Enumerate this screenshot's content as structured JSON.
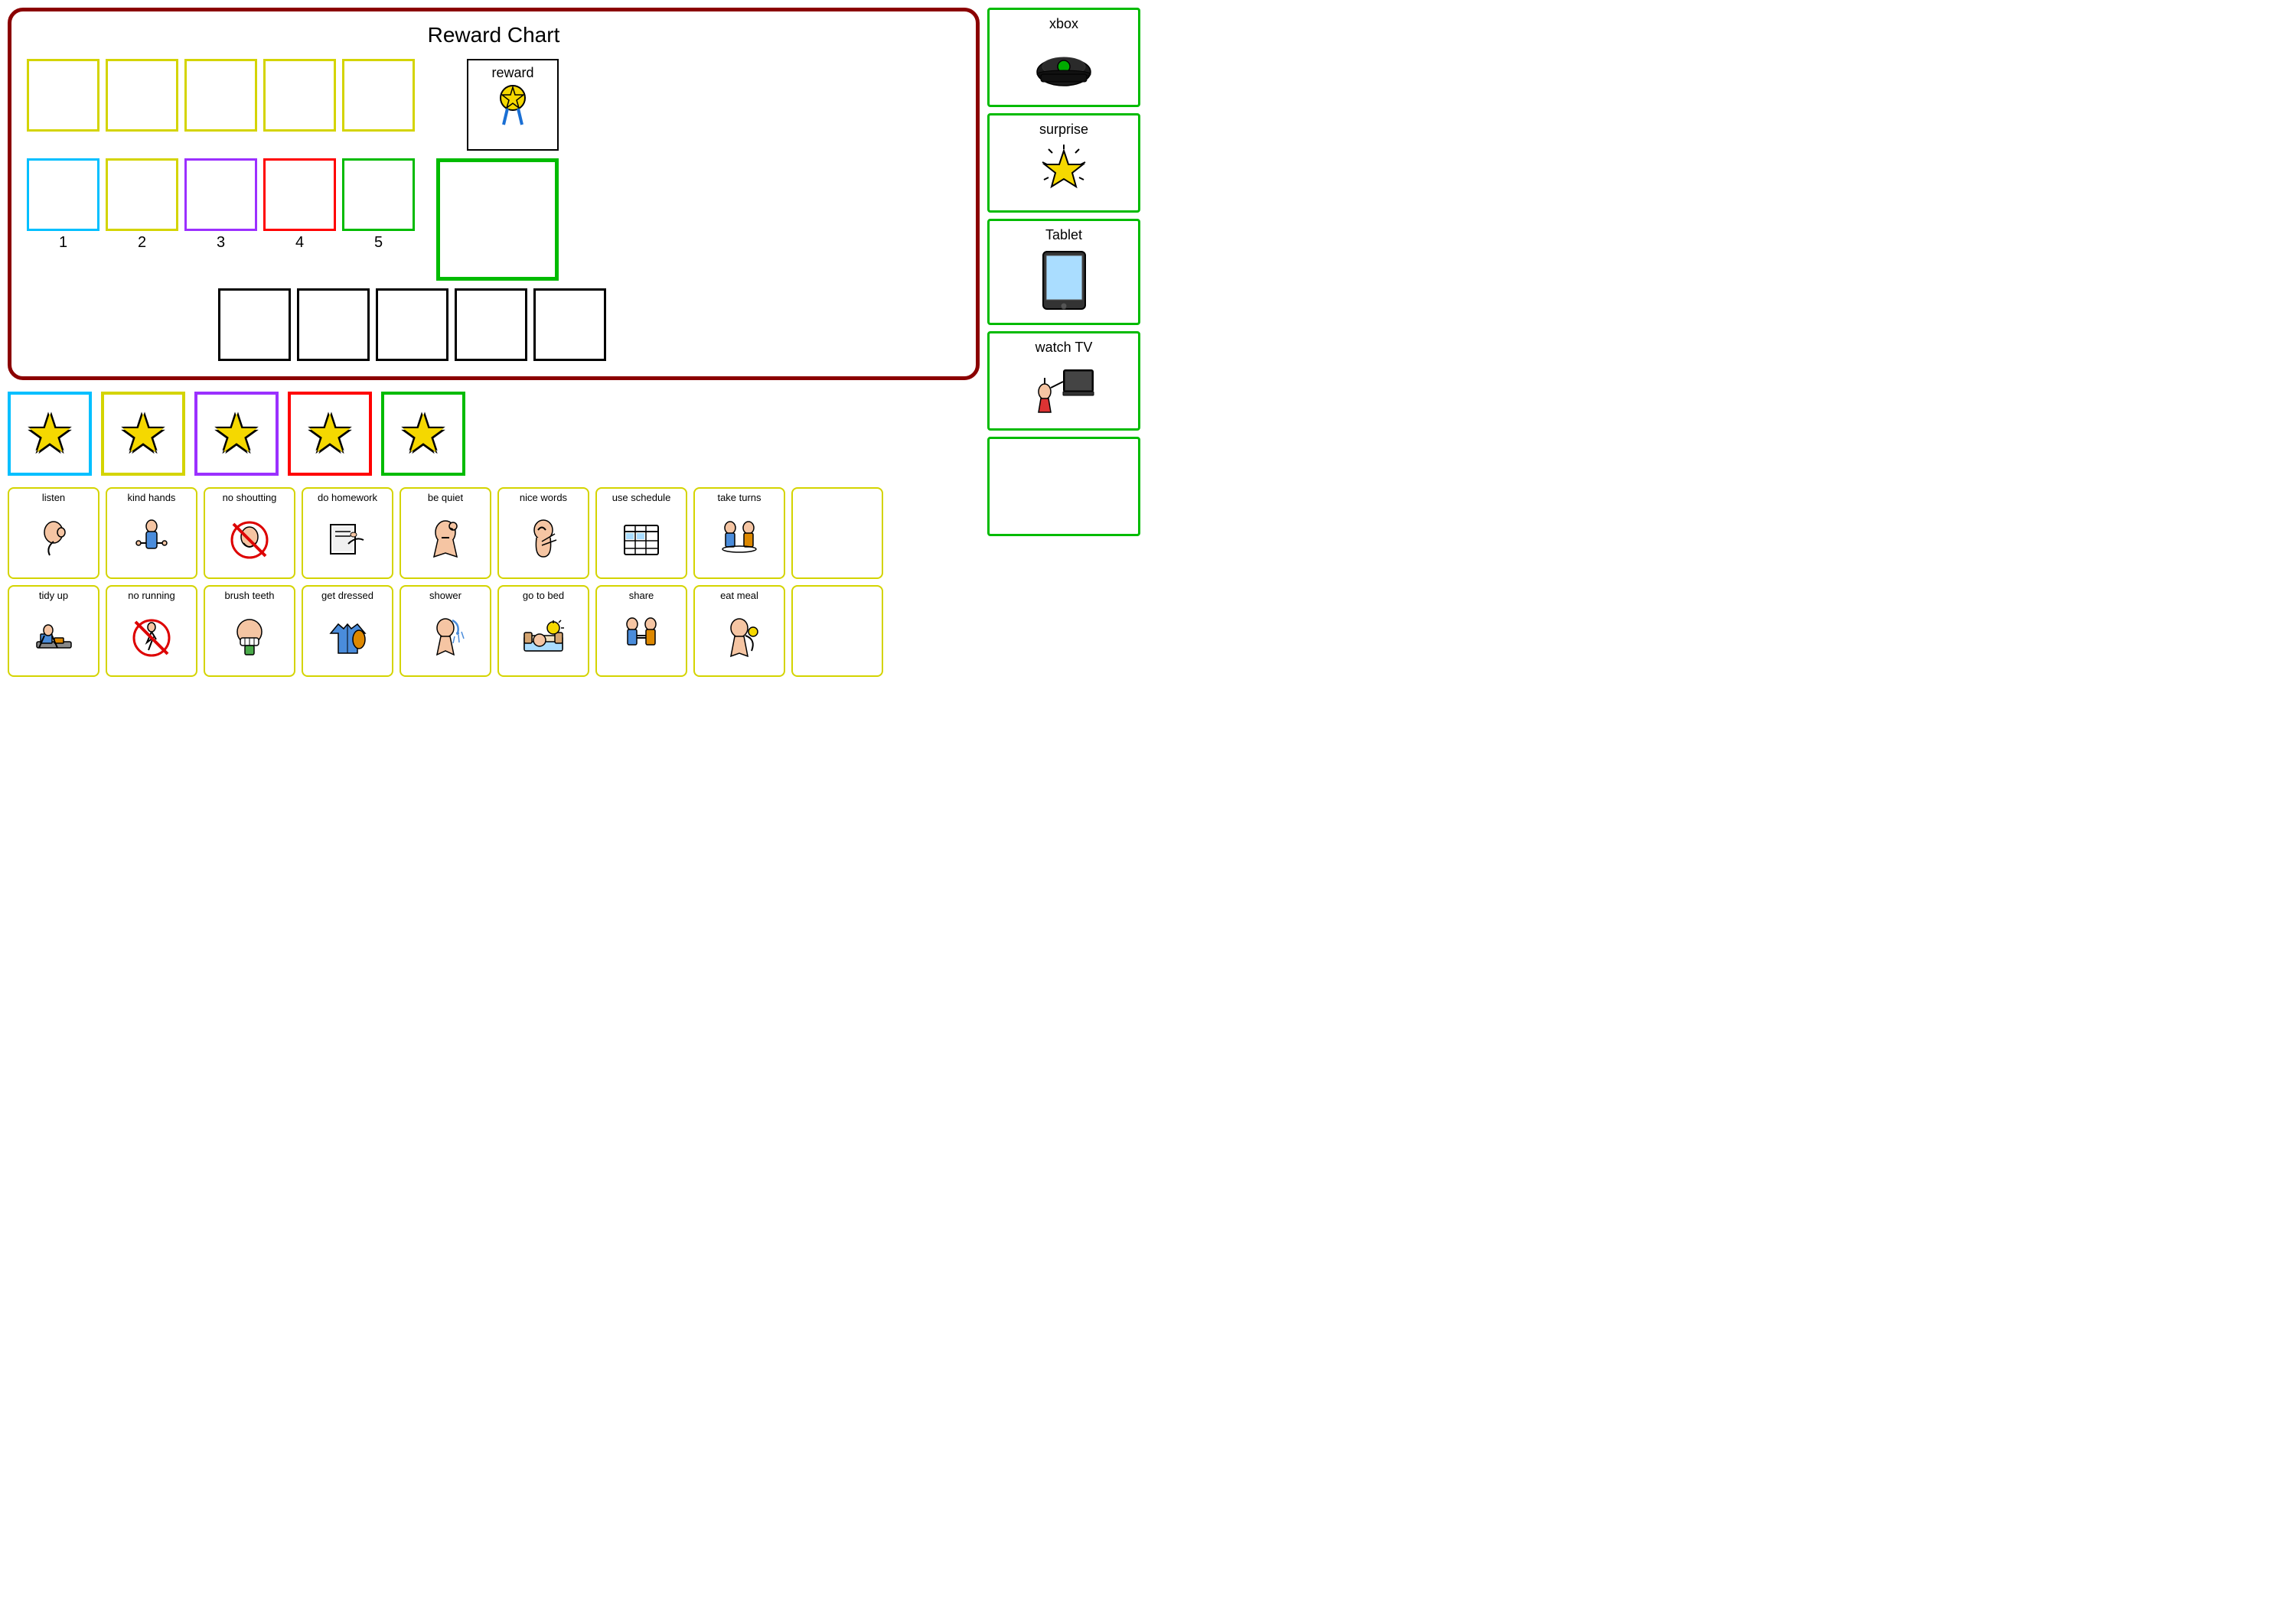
{
  "rewardChart": {
    "title": "Reward Chart",
    "rewardLabel": "reward",
    "rows": {
      "topSlots": [
        "",
        "",
        "",
        "",
        ""
      ],
      "midSlots": [
        {
          "color": "cyan",
          "number": "1"
        },
        {
          "color": "yellow",
          "number": "2"
        },
        {
          "color": "purple",
          "number": "3"
        },
        {
          "color": "red",
          "number": "4"
        },
        {
          "color": "green",
          "number": "5"
        }
      ],
      "blackSlots": [
        "",
        "",
        "",
        "",
        ""
      ]
    }
  },
  "stars": [
    {
      "color": "cyan"
    },
    {
      "color": "yellow"
    },
    {
      "color": "purple"
    },
    {
      "color": "red"
    },
    {
      "color": "green"
    }
  ],
  "taskCards": {
    "row1": [
      {
        "label": "listen",
        "icon": "ear"
      },
      {
        "label": "kind hands",
        "icon": "hands"
      },
      {
        "label": "no shoutting",
        "icon": "no-shout"
      },
      {
        "label": "do homework",
        "icon": "homework"
      },
      {
        "label": "be quiet",
        "icon": "quiet"
      },
      {
        "label": "nice words",
        "icon": "words"
      },
      {
        "label": "use schedule",
        "icon": "schedule"
      },
      {
        "label": "take turns",
        "icon": "turns"
      },
      {
        "label": "",
        "icon": "empty"
      }
    ],
    "row2": [
      {
        "label": "tidy up",
        "icon": "tidy"
      },
      {
        "label": "no running",
        "icon": "no-run"
      },
      {
        "label": "brush teeth",
        "icon": "teeth"
      },
      {
        "label": "get dressed",
        "icon": "dressed"
      },
      {
        "label": "shower",
        "icon": "shower"
      },
      {
        "label": "go to bed",
        "icon": "bed"
      },
      {
        "label": "share",
        "icon": "share"
      },
      {
        "label": "eat meal",
        "icon": "meal"
      },
      {
        "label": "",
        "icon": "empty"
      }
    ]
  },
  "rewardItems": [
    {
      "label": "xbox",
      "icon": "xbox"
    },
    {
      "label": "surprise",
      "icon": "surprise"
    },
    {
      "label": "Tablet",
      "icon": "tablet"
    },
    {
      "label": "watch TV",
      "icon": "tv"
    },
    {
      "label": "",
      "icon": "empty"
    }
  ]
}
